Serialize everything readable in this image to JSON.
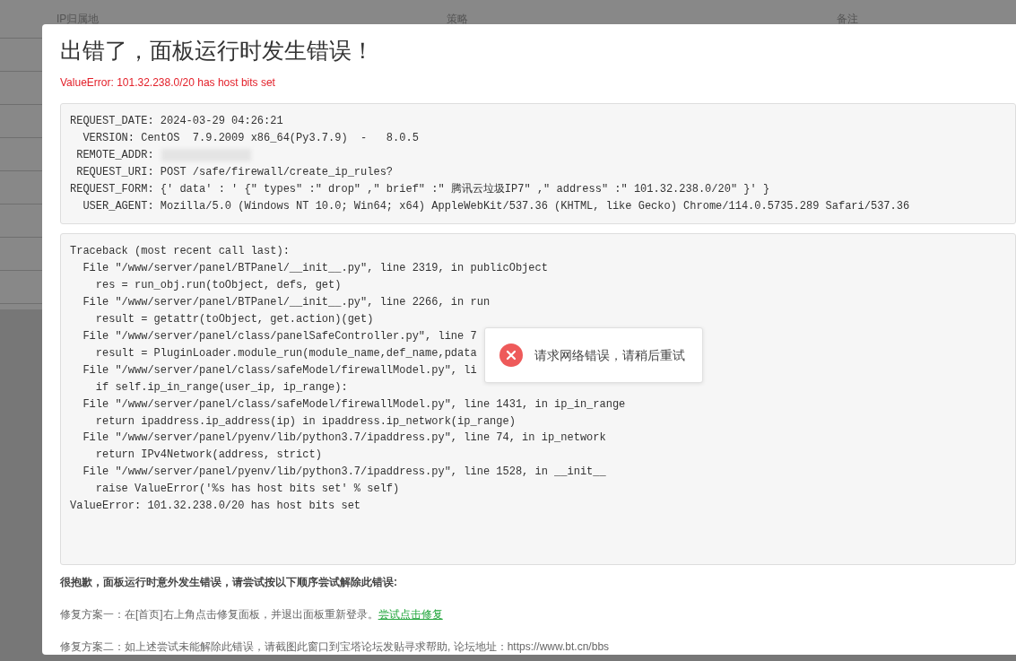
{
  "background_table": {
    "columns": [
      "IP归属地",
      "策略",
      "备注"
    ]
  },
  "error_dialog": {
    "title": "出错了，面板运行时发生错误！",
    "error_message": "ValueError: 101.32.238.0/20 has host bits set",
    "request_info": [
      "REQUEST_DATE: 2024-03-29 04:26:21",
      "  VERSION: CentOS  7.9.2009 x86_64(Py3.7.9)  -   8.0.5",
      " REMOTE_ADDR:",
      " REQUEST_URI: POST /safe/firewall/create_ip_rules?",
      "REQUEST_FORM: {' data' : ' {\" types\" :\" drop\" ,\" brief\" :\" 腾讯云垃圾IP7\" ,\" address\" :\" 101.32.238.0/20\" }' }",
      "  USER_AGENT: Mozilla/5.0 (Windows NT 10.0; Win64; x64) AppleWebKit/537.36 (KHTML, like Gecko) Chrome/114.0.5735.289 Safari/537.36"
    ],
    "traceback": [
      "Traceback (most recent call last):",
      "  File \"/www/server/panel/BTPanel/__init__.py\", line 2319, in publicObject",
      "    res = run_obj.run(toObject, defs, get)",
      "  File \"/www/server/panel/BTPanel/__init__.py\", line 2266, in run",
      "    result = getattr(toObject, get.action)(get)",
      "  File \"/www/server/panel/class/panelSafeController.py\", line 7",
      "    result = PluginLoader.module_run(module_name,def_name,pdata",
      "  File \"/www/server/panel/class/safeModel/firewallModel.py\", li",
      "    if self.ip_in_range(user_ip, ip_range):",
      "  File \"/www/server/panel/class/safeModel/firewallModel.py\", line 1431, in ip_in_range",
      "    return ipaddress.ip_address(ip) in ipaddress.ip_network(ip_range)",
      "  File \"/www/server/panel/pyenv/lib/python3.7/ipaddress.py\", line 74, in ip_network",
      "    return IPv4Network(address, strict)",
      "  File \"/www/server/panel/pyenv/lib/python3.7/ipaddress.py\", line 1528, in __init__",
      "    raise ValueError('%s has host bits set' % self)",
      "ValueError: 101.32.238.0/20 has host bits set"
    ],
    "apology": "很抱歉，面板运行时意外发生错误，请尝试按以下顺序尝试解除此错误:",
    "fixes": [
      {
        "text": "修复方案一：在[首页]右上角点击修复面板，并退出面板重新登录。",
        "link": "尝试点击修复"
      },
      {
        "text": "修复方案二：如上述尝试未能解除此错误，请截图此窗口到宝塔论坛发贴寻求帮助, 论坛地址：https://www.bt.cn/bbs"
      }
    ]
  },
  "toast": {
    "kind": "error",
    "message": "请求网络错误，请稍后重试"
  }
}
